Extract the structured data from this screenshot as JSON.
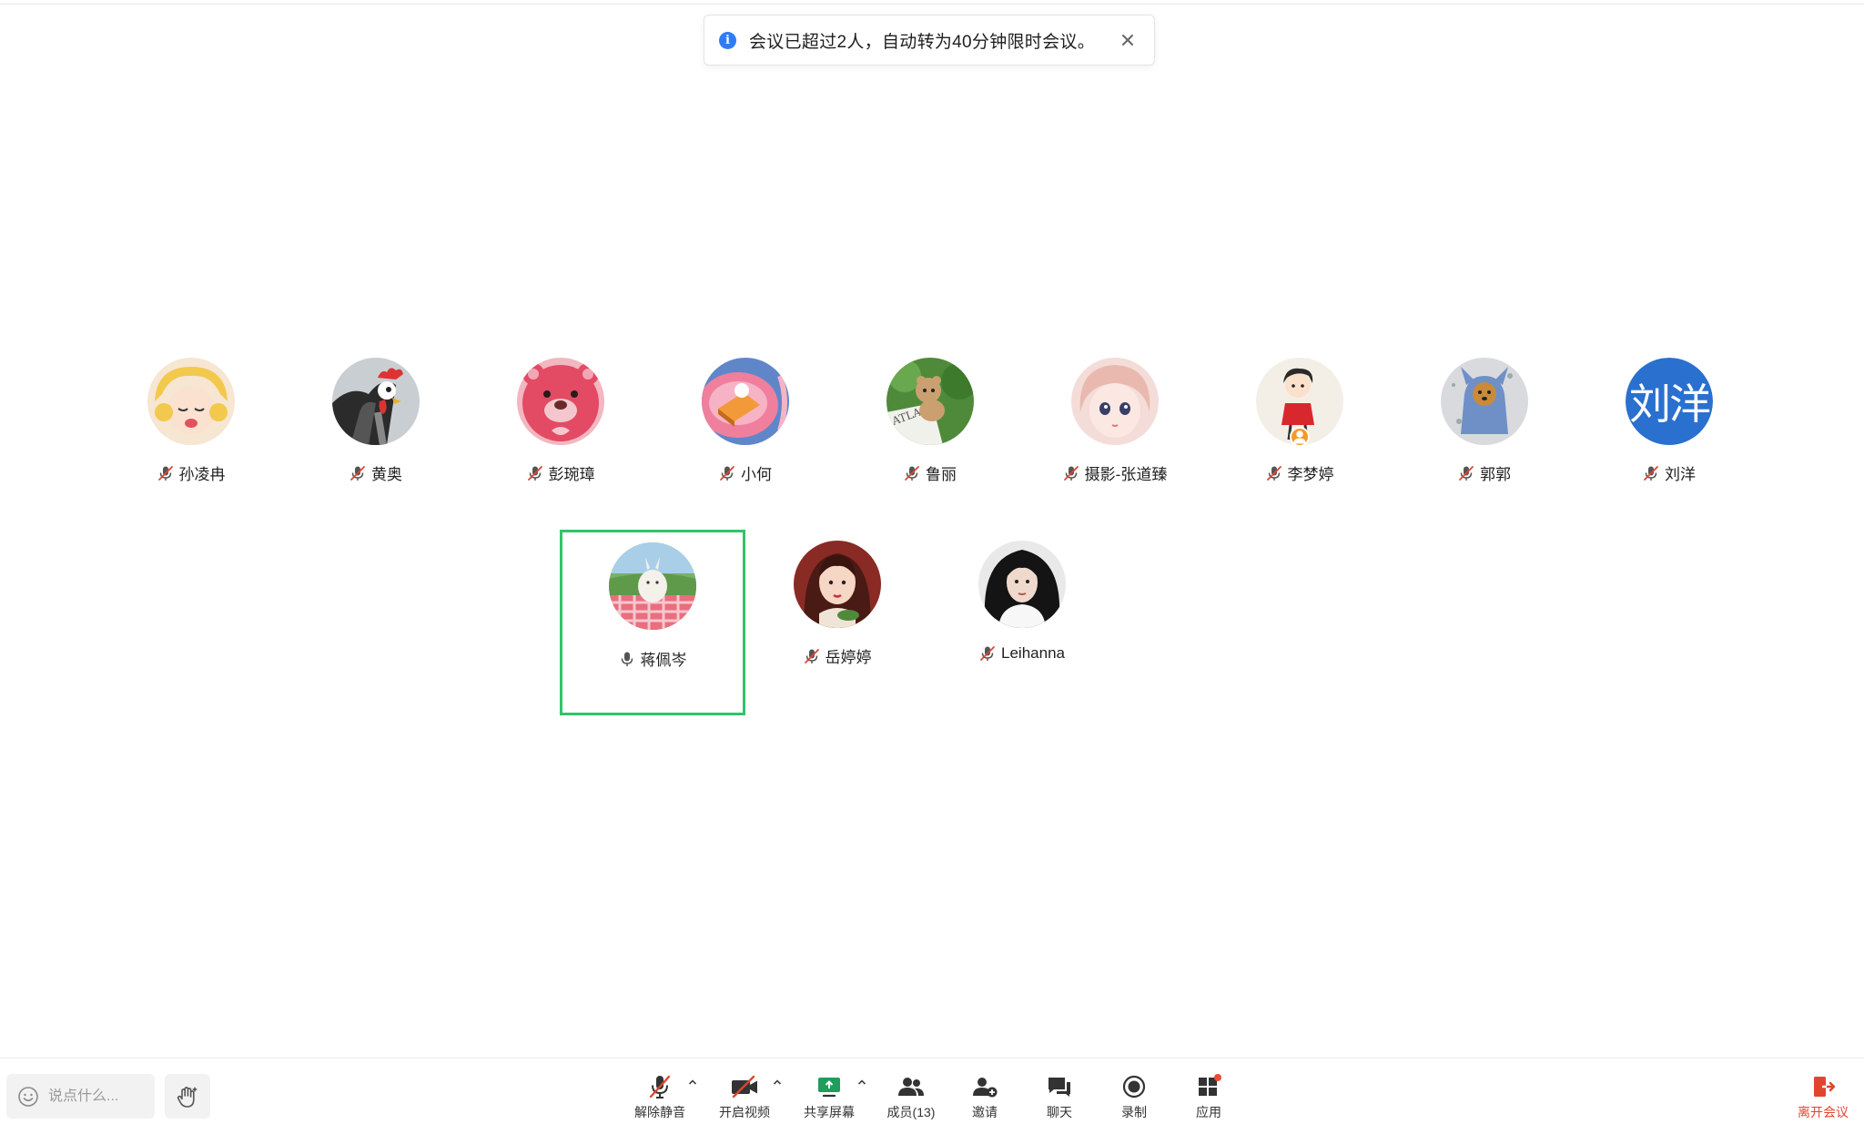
{
  "notification": {
    "message": "会议已超过2人，自动转为40分钟限时会议。"
  },
  "participants": [
    {
      "name": "孙凌冉",
      "muted": true
    },
    {
      "name": "黄奥",
      "muted": true
    },
    {
      "name": "彭琬璋",
      "muted": true
    },
    {
      "name": "小何",
      "muted": true
    },
    {
      "name": "鲁丽",
      "muted": true
    },
    {
      "name": "摄影-张道臻",
      "muted": true
    },
    {
      "name": "李梦婷",
      "muted": true,
      "host": true
    },
    {
      "name": "郭郭",
      "muted": true
    },
    {
      "name": "刘洋",
      "muted": true,
      "avatar_text": "刘洋"
    },
    {
      "name": "蒋佩岑",
      "muted": false,
      "speaking": true
    },
    {
      "name": "岳婷婷",
      "muted": true
    },
    {
      "name": "Leihanna",
      "muted": true
    }
  ],
  "toolbar": {
    "chat_placeholder": "说点什么...",
    "unmute": "解除静音",
    "video": "开启视频",
    "share": "共享屏幕",
    "members": "成员(13)",
    "invite": "邀请",
    "chat": "聊天",
    "record": "录制",
    "apps": "应用",
    "leave": "离开会议"
  },
  "colors": {
    "accent_green": "#2fc56b",
    "info_blue": "#2f7cf6",
    "danger_red": "#e0462f",
    "muted_red": "#d9472f",
    "avatar_blue": "#2a70cf"
  }
}
